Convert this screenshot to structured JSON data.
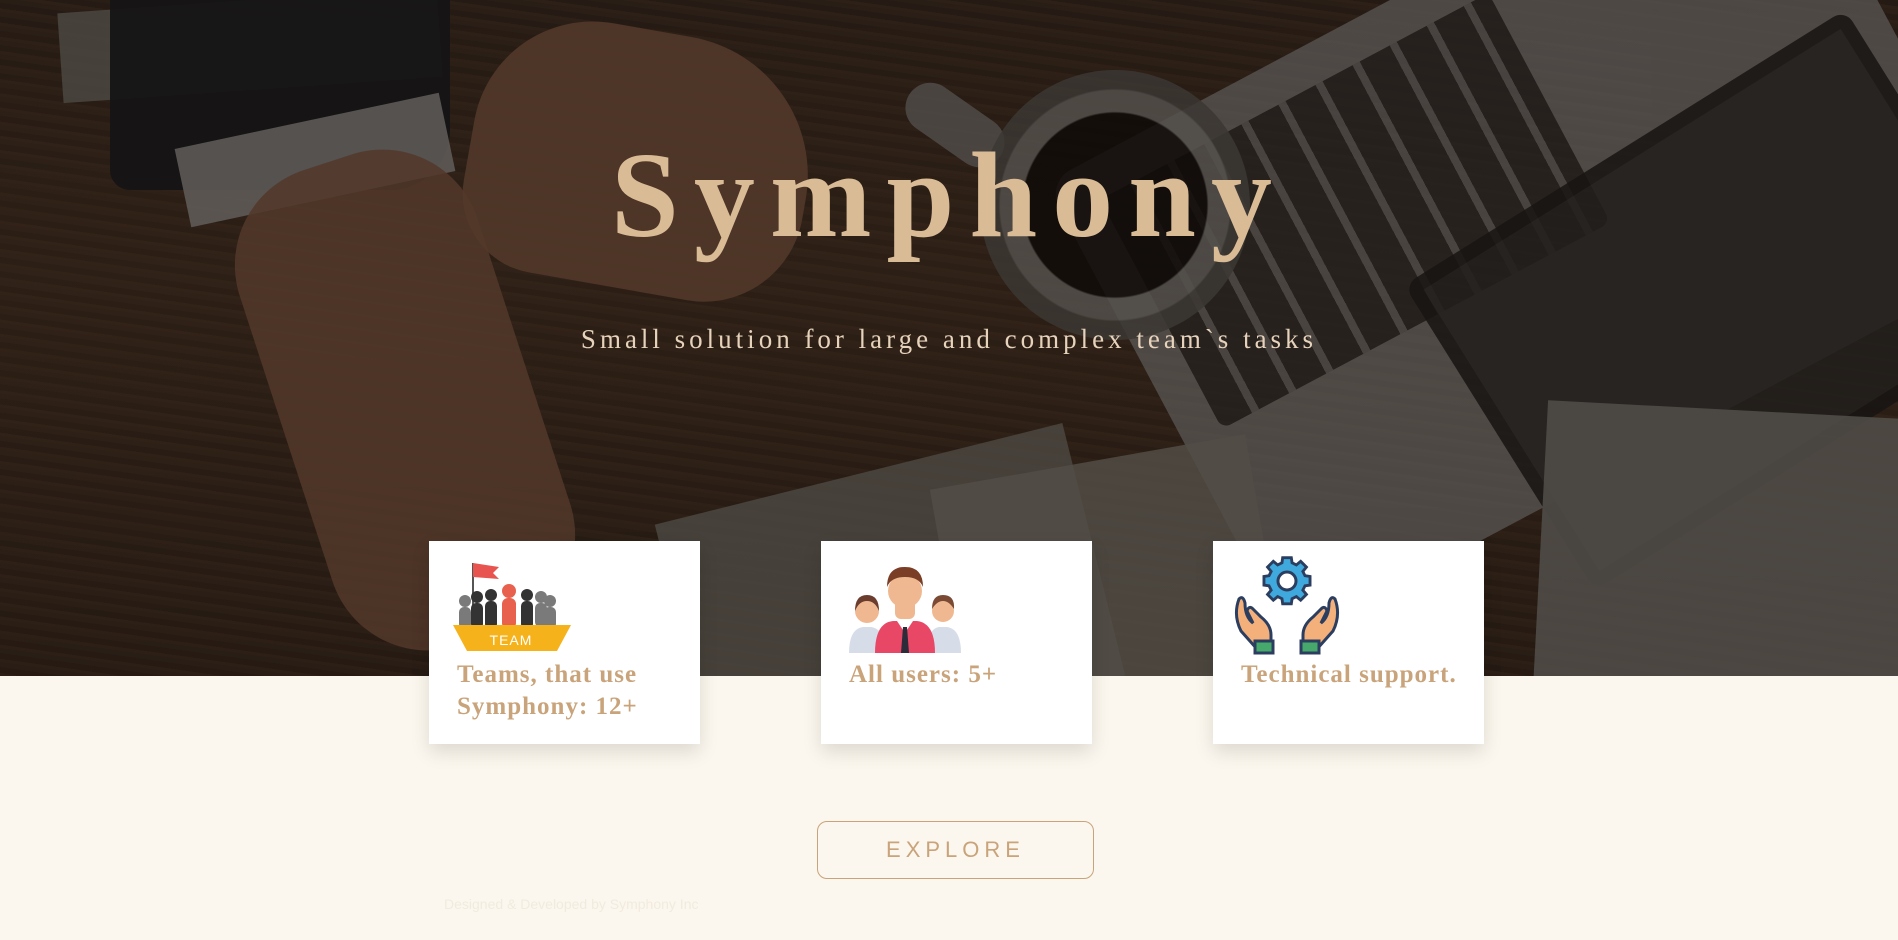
{
  "hero": {
    "title": "Symphony",
    "subtitle": "Small solution for large and complex team`s tasks"
  },
  "stats": [
    {
      "label": "Teams, that use Symphony: 12+",
      "icon": "team-flag-icon"
    },
    {
      "label": "All users: 5+",
      "icon": "users-group-icon"
    },
    {
      "label": "Technical support.",
      "icon": "hands-gear-icon"
    }
  ],
  "icons": {
    "team_badge": "TEAM"
  },
  "explore": {
    "label": "EXPLORE"
  },
  "footer": {
    "text": "Designed & Developed by Symphony Inc"
  },
  "colors": {
    "accent": "#c9a37a",
    "title": "#d9bb96",
    "page_background": "#fbf7ee",
    "card_background": "#ffffff"
  }
}
